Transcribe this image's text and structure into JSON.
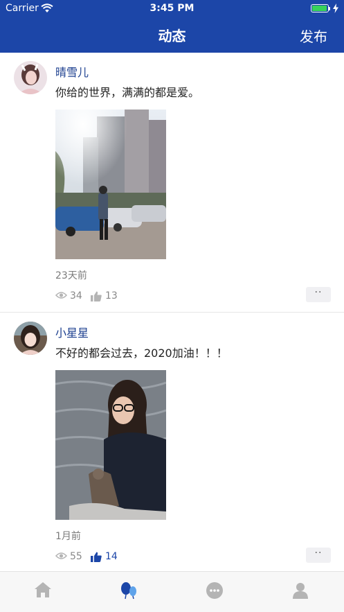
{
  "status_bar": {
    "carrier": "Carrier",
    "time": "3:45 PM",
    "battery_percent": 100
  },
  "nav": {
    "title": "动态",
    "action": "发布"
  },
  "posts": [
    {
      "username": "晴雪儿",
      "content": "你给的世界，满满的都是爱。",
      "time_ago": "23天前",
      "views": "34",
      "likes": "13",
      "liked": false,
      "more": "··"
    },
    {
      "username": "小星星",
      "content": "不好的都会过去，2020加油！！！",
      "time_ago": "1月前",
      "views": "55",
      "likes": "14",
      "liked": true,
      "more": "··"
    }
  ],
  "tabbar": {
    "items": [
      {
        "icon": "home-icon",
        "active": false
      },
      {
        "icon": "moments-icon",
        "active": true
      },
      {
        "icon": "message-icon",
        "active": false
      },
      {
        "icon": "profile-icon",
        "active": false
      }
    ]
  },
  "colors": {
    "brand": "#1c46a8",
    "liked": "#1c46a8",
    "username": "#1c3f8f",
    "tab_inactive": "#b4b4b4"
  }
}
